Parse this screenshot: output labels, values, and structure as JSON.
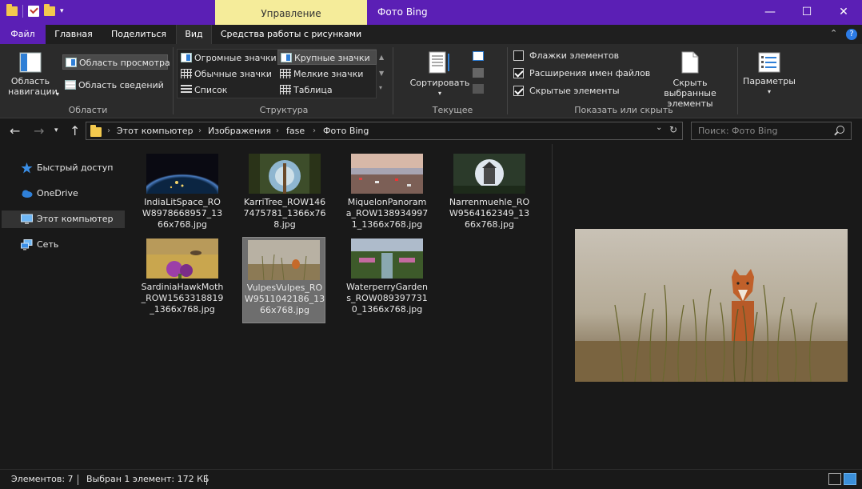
{
  "window": {
    "title": "Фото Bing",
    "context_tab_header": "Управление",
    "controls": {
      "minimize": "—",
      "maximize": "☐",
      "close": "✕"
    }
  },
  "tabs": [
    {
      "label": "Файл"
    },
    {
      "label": "Главная"
    },
    {
      "label": "Поделиться"
    },
    {
      "label": "Вид"
    },
    {
      "label": "Средства работы с рисунками"
    }
  ],
  "ribbon": {
    "panes": {
      "nav_pane_label": "Область навигации",
      "preview_pane": "Область просмотра",
      "details_pane": "Область сведений",
      "group_label": "Области"
    },
    "layout": {
      "items": [
        "Огромные значки",
        "Крупные значки",
        "Обычные значки",
        "Мелкие значки",
        "Список",
        "Таблица"
      ],
      "selected": "Крупные значки",
      "group_label": "Структура"
    },
    "current_view": {
      "sort_label": "Сортировать",
      "group_label": "Текущее представление"
    },
    "show_hide": {
      "checkboxes": [
        {
          "label": "Флажки элементов",
          "checked": false
        },
        {
          "label": "Расширения имен файлов",
          "checked": true
        },
        {
          "label": "Скрытые элементы",
          "checked": true
        }
      ],
      "hide_selected": "Скрыть выбранные элементы",
      "group_label": "Показать или скрыть"
    },
    "options_label": "Параметры"
  },
  "address": {
    "crumbs": [
      "Этот компьютер",
      "Изображения",
      "fase",
      "Фото Bing"
    ],
    "search_placeholder": "Поиск: Фото Bing"
  },
  "nav": [
    {
      "label": "Быстрый доступ",
      "icon": "star-icon"
    },
    {
      "label": "OneDrive",
      "icon": "cloud-icon"
    },
    {
      "label": "Этот компьютер",
      "icon": "computer-icon",
      "selected": true
    },
    {
      "label": "Сеть",
      "icon": "network-icon"
    }
  ],
  "files": [
    {
      "name": "IndiaLitSpace_ROW8978668957_1366x768.jpg"
    },
    {
      "name": "KarriTree_ROW1467475781_1366x768.jpg"
    },
    {
      "name": "MiquelonPanorama_ROW1389349971_1366x768.jpg"
    },
    {
      "name": "Narrenmuehle_ROW9564162349_1366x768.jpg"
    },
    {
      "name": "SardiniaHawkMoth_ROW1563318819_1366x768.jpg"
    },
    {
      "name": "VulpesVulpes_ROW9511042186_1366x768.jpg",
      "selected": true
    },
    {
      "name": "WaterperryGardens_ROW0893977310_1366x768.jpg"
    }
  ],
  "status": {
    "count": "Элементов: 7",
    "selection": "Выбран 1 элемент: 172 КБ"
  },
  "colors": {
    "titlebar": "#5b1fb5",
    "context_tab": "#f5ec9a",
    "background": "#191919"
  }
}
